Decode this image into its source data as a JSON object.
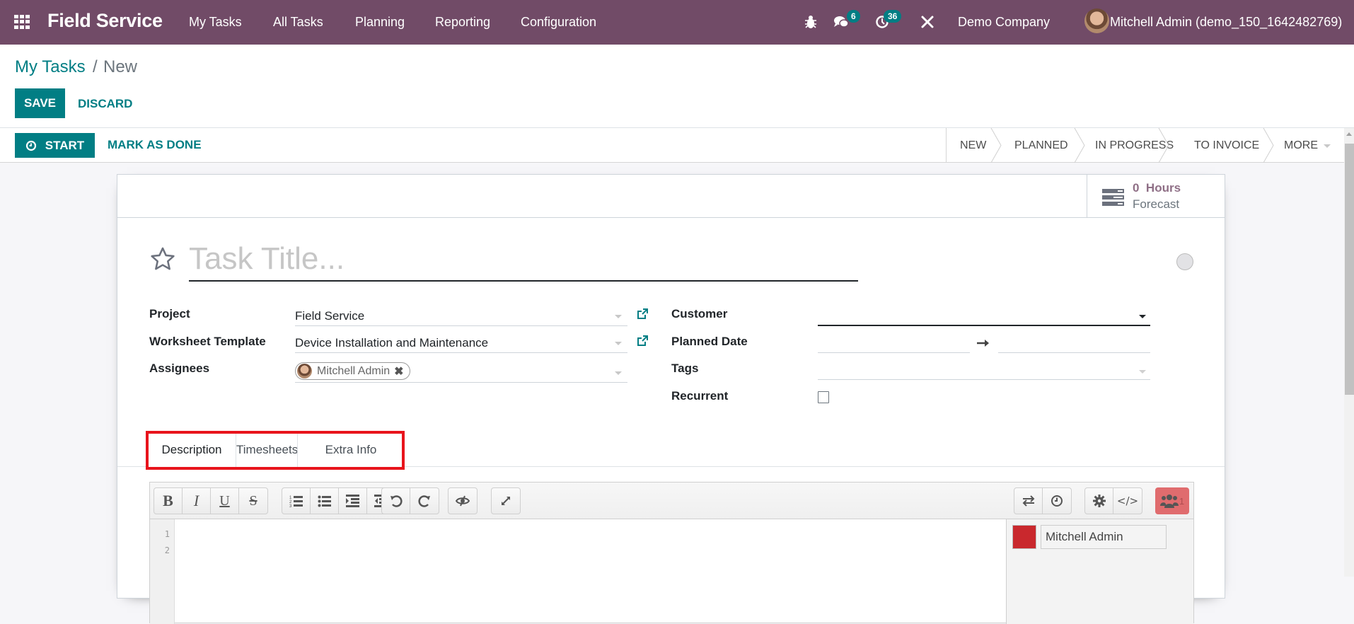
{
  "navbar": {
    "app_name": "Field Service",
    "menu": [
      "My Tasks",
      "All Tasks",
      "Planning",
      "Reporting",
      "Configuration"
    ],
    "icons": {
      "apps": "apps-grid-icon",
      "debug": "bug-icon",
      "messages": "chat-icon",
      "activities": "clock-icon",
      "tools": "tools-icon"
    },
    "messages_count": "6",
    "activities_count": "36",
    "company": "Demo Company",
    "user": "Mitchell Admin (demo_150_1642482769)",
    "color": "#714b67"
  },
  "breadcrumb": {
    "parent": "My Tasks",
    "separator": "/",
    "current": "New"
  },
  "actions": {
    "save": "SAVE",
    "discard": "DISCARD"
  },
  "header_buttons": {
    "start": "START",
    "mark_done": "MARK AS DONE"
  },
  "stages": [
    "NEW",
    "PLANNED",
    "IN PROGRESS",
    "TO INVOICE",
    "MORE"
  ],
  "stat_button": {
    "value": "0",
    "unit": "Hours",
    "label": "Forecast"
  },
  "form": {
    "title_placeholder": "Task Title...",
    "priority_starred": false,
    "left_fields": [
      {
        "label": "Project",
        "value": "Field Service"
      },
      {
        "label": "Worksheet Template",
        "value": "Device Installation and Maintenance"
      },
      {
        "label": "Assignees",
        "tag": "Mitchell Admin"
      }
    ],
    "right_fields": [
      {
        "label": "Customer",
        "value": ""
      },
      {
        "label": "Planned Date",
        "start": "",
        "end": ""
      },
      {
        "label": "Tags",
        "value": ""
      },
      {
        "label": "Recurrent",
        "checked": false
      }
    ]
  },
  "tabs": [
    "Description",
    "Timesheets",
    "Extra Info"
  ],
  "active_tab": "Description",
  "editor": {
    "line_numbers": [
      "1",
      "2"
    ],
    "collaborator": "Mitchell Admin",
    "collaborator_count": "1",
    "collaborator_color": "#c9282d"
  },
  "accent_color": "#017e84",
  "highlight_color": "#e8141c"
}
